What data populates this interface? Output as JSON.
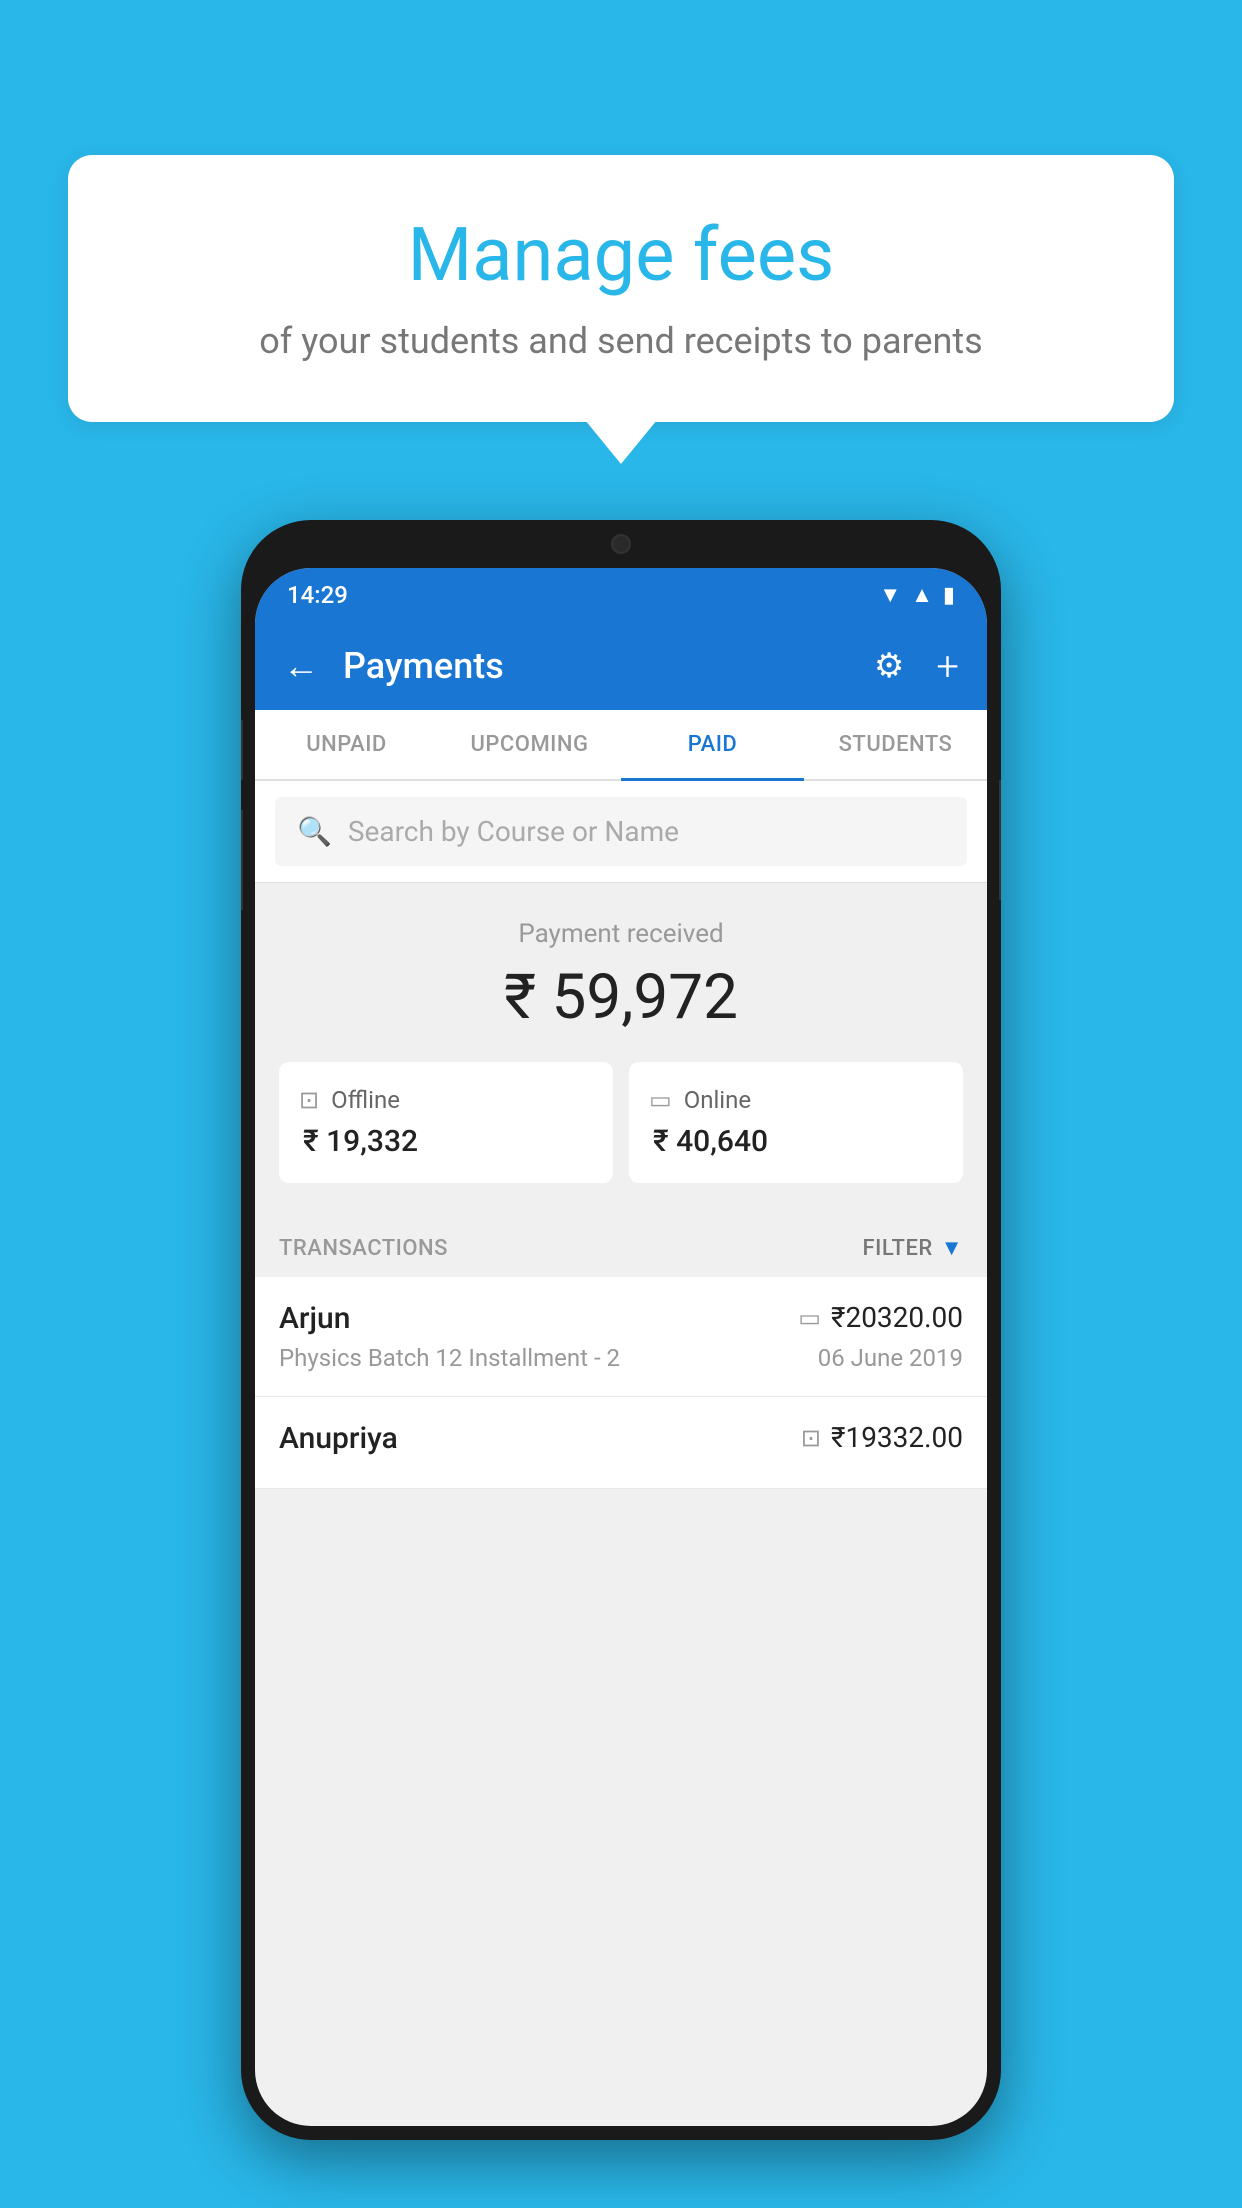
{
  "background_color": "#29b6e8",
  "speech_bubble": {
    "title": "Manage fees",
    "subtitle": "of your students and send receipts to parents"
  },
  "phone": {
    "status_bar": {
      "time": "14:29"
    },
    "app_bar": {
      "title": "Payments",
      "back_label": "←",
      "gear_label": "⚙",
      "plus_label": "+"
    },
    "tabs": [
      {
        "label": "UNPAID",
        "active": false
      },
      {
        "label": "UPCOMING",
        "active": false
      },
      {
        "label": "PAID",
        "active": true
      },
      {
        "label": "STUDENTS",
        "active": false
      }
    ],
    "search": {
      "placeholder": "Search by Course or Name"
    },
    "payment_summary": {
      "label": "Payment received",
      "amount": "₹ 59,972",
      "offline": {
        "label": "Offline",
        "amount": "₹ 19,332"
      },
      "online": {
        "label": "Online",
        "amount": "₹ 40,640"
      }
    },
    "transactions": {
      "header_label": "TRANSACTIONS",
      "filter_label": "FILTER",
      "items": [
        {
          "name": "Arjun",
          "course": "Physics Batch 12 Installment - 2",
          "amount": "₹20320.00",
          "date": "06 June 2019",
          "payment_type": "online"
        },
        {
          "name": "Anupriya",
          "course": "",
          "amount": "₹19332.00",
          "date": "",
          "payment_type": "offline"
        }
      ]
    }
  }
}
